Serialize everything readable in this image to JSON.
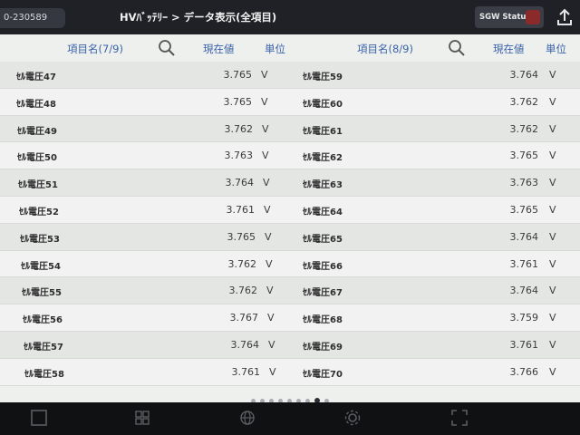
{
  "header": {
    "vin": "0-230589",
    "title": "HVﾊﾞｯﾃﾘｰ > データ表示(全項目)",
    "sgw_label": "SGW Status"
  },
  "left_table": {
    "col_name": "項目名(7/9)",
    "col_value": "現在値",
    "col_unit": "単位",
    "rows": [
      {
        "name": "ｾﾙ電圧47",
        "value": "3.765",
        "unit": "V"
      },
      {
        "name": "ｾﾙ電圧48",
        "value": "3.765",
        "unit": "V"
      },
      {
        "name": "ｾﾙ電圧49",
        "value": "3.762",
        "unit": "V"
      },
      {
        "name": "ｾﾙ電圧50",
        "value": "3.763",
        "unit": "V"
      },
      {
        "name": "ｾﾙ電圧51",
        "value": "3.764",
        "unit": "V"
      },
      {
        "name": "ｾﾙ電圧52",
        "value": "3.761",
        "unit": "V"
      },
      {
        "name": "ｾﾙ電圧53",
        "value": "3.765",
        "unit": "V"
      },
      {
        "name": "ｾﾙ電圧54",
        "value": "3.762",
        "unit": "V"
      },
      {
        "name": "ｾﾙ電圧55",
        "value": "3.762",
        "unit": "V"
      },
      {
        "name": "ｾﾙ電圧56",
        "value": "3.767",
        "unit": "V"
      },
      {
        "name": "ｾﾙ電圧57",
        "value": "3.764",
        "unit": "V"
      },
      {
        "name": "ｾﾙ電圧58",
        "value": "3.761",
        "unit": "V"
      }
    ]
  },
  "right_table": {
    "col_name": "項目名(8/9)",
    "col_value": "現在値",
    "col_unit": "単位",
    "rows": [
      {
        "name": "ｾﾙ電圧59",
        "value": "3.764",
        "unit": "V"
      },
      {
        "name": "ｾﾙ電圧60",
        "value": "3.762",
        "unit": "V"
      },
      {
        "name": "ｾﾙ電圧61",
        "value": "3.762",
        "unit": "V"
      },
      {
        "name": "ｾﾙ電圧62",
        "value": "3.765",
        "unit": "V"
      },
      {
        "name": "ｾﾙ電圧63",
        "value": "3.763",
        "unit": "V"
      },
      {
        "name": "ｾﾙ電圧64",
        "value": "3.765",
        "unit": "V"
      },
      {
        "name": "ｾﾙ電圧65",
        "value": "3.764",
        "unit": "V"
      },
      {
        "name": "ｾﾙ電圧66",
        "value": "3.761",
        "unit": "V"
      },
      {
        "name": "ｾﾙ電圧67",
        "value": "3.764",
        "unit": "V"
      },
      {
        "name": "ｾﾙ電圧68",
        "value": "3.759",
        "unit": "V"
      },
      {
        "name": "ｾﾙ電圧69",
        "value": "3.761",
        "unit": "V"
      },
      {
        "name": "ｾﾙ電圧70",
        "value": "3.766",
        "unit": "V"
      }
    ]
  },
  "pagination": {
    "total": 9,
    "current": 8
  },
  "icons": {
    "search": "search-icon",
    "export": "export-icon",
    "nav": [
      "square-icon",
      "grid-icon",
      "globe-icon",
      "gear-icon",
      "fullscreen-icon"
    ]
  },
  "colors": {
    "header_text": "#3a62a8",
    "topbar": "#1f2126",
    "row_odd": "#e4e6e4",
    "row_even": "#f1f2f1"
  }
}
